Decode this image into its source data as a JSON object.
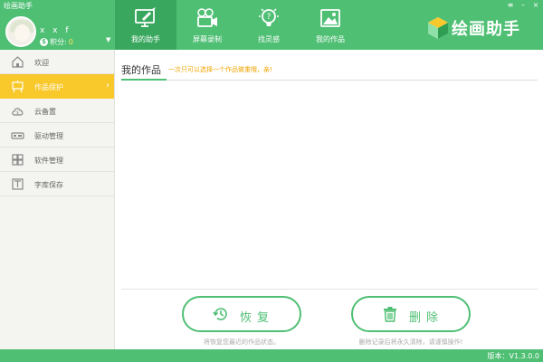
{
  "window": {
    "title": "绘画助手",
    "controls": [
      "≡",
      "–",
      "×"
    ]
  },
  "user": {
    "name": "x x f",
    "points_label": "积分:",
    "points_value": "0",
    "coin_glyph": "$",
    "dropdown_glyph": "▼"
  },
  "tabs": [
    {
      "label": "我的助手",
      "icon": "monitor-pen-icon",
      "active": true
    },
    {
      "label": "屏幕录制",
      "icon": "video-camera-icon",
      "active": false
    },
    {
      "label": "找灵感",
      "icon": "lightbulb-icon",
      "active": false
    },
    {
      "label": "我的作品",
      "icon": "picture-icon",
      "active": false
    }
  ],
  "brand": {
    "name": "绘画助手",
    "logo_icon": "cube-logo-icon"
  },
  "sidebar": {
    "items": [
      {
        "label": "欢迎",
        "icon": "home-icon",
        "active": false
      },
      {
        "label": "作品保护",
        "icon": "easel-icon",
        "active": true
      },
      {
        "label": "云备置",
        "icon": "cloud-icon",
        "active": false
      },
      {
        "label": "驱动管理",
        "icon": "driver-icon",
        "active": false
      },
      {
        "label": "软件管理",
        "icon": "grid-icon",
        "active": false
      },
      {
        "label": "字库保存",
        "icon": "font-icon",
        "active": false
      }
    ],
    "active_arrow": "›"
  },
  "main": {
    "section_title": "我的作品",
    "section_hint": "一次只可以选择一个作品做重哦，亲!",
    "restore": {
      "label": "恢复",
      "icon": "history-icon",
      "hint": "将恢复您最近的作品状态。"
    },
    "delete": {
      "label": "删除",
      "icon": "trash-icon",
      "hint": "删除记录后将永久清除，请谨慎操作!"
    }
  },
  "status": {
    "version": "版本：V1.3.0.0"
  },
  "colors": {
    "primary": "#4fbf74",
    "primary_dark": "#39a85e",
    "accent": "#f9c82b",
    "hint": "#f0a400"
  }
}
